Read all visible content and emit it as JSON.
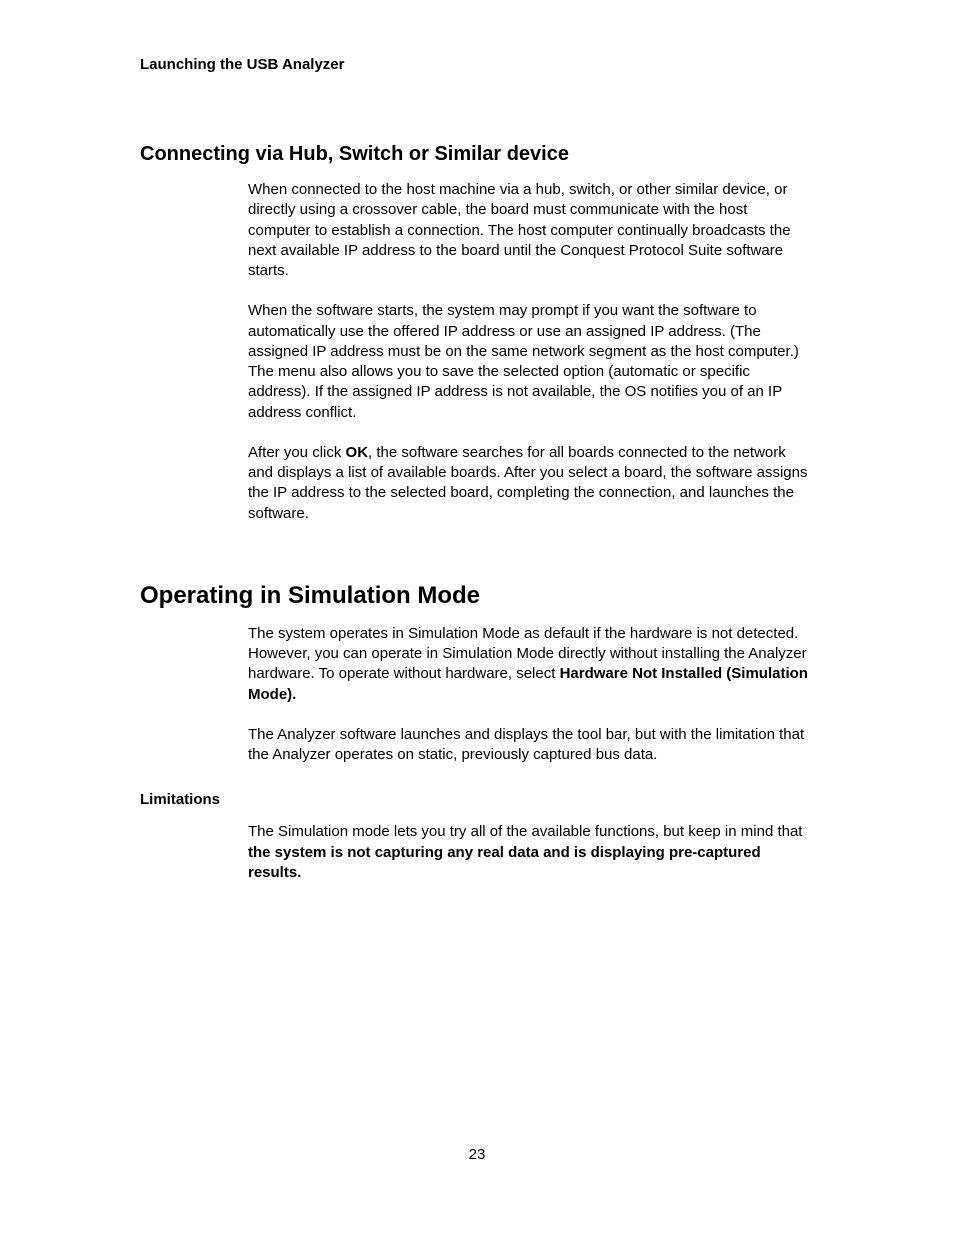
{
  "header": {
    "running": "Launching the USB Analyzer"
  },
  "section1": {
    "heading": "Connecting via Hub, Switch or Similar device",
    "p1": "When connected to the host machine via a hub, switch, or other similar device, or directly using a crossover cable, the board must communicate with the host computer to establish a connection. The host computer continually broadcasts the next available IP address to the board until the Conquest Protocol Suite software starts.",
    "p2": "When the software starts, the system may prompt if you want the software to automatically use the offered IP address or use an assigned IP address. (The assigned IP address must be on the same network segment as the host computer.) The menu also allows you to save the selected option (automatic or specific address). If the assigned IP address is not available, the OS notifies you of an IP address conflict.",
    "p3_a": "After you click ",
    "p3_bold": "OK",
    "p3_b": ", the software searches for all boards connected to the network and displays a list of available boards. After you select a board, the software assigns the IP address to the selected board, completing the connection, and launches the software."
  },
  "section2": {
    "heading": "Operating in Simulation Mode",
    "p1_a": "The system operates in Simulation Mode as default if the hardware is not detected. However, you can operate in Simulation Mode directly without installing the Analyzer hardware. To operate without hardware, select ",
    "p1_bold": "Hardware Not Installed (Simulation Mode).",
    "p2": "The Analyzer software launches and displays the tool bar, but with the limitation that the Analyzer operates on static, previously captured bus data.",
    "sub_heading": "Limitations",
    "p3_a": "The Simulation mode lets you try all of the available functions, but keep in mind that ",
    "p3_bold": "the system is not capturing any real data and is displaying pre-captured results."
  },
  "page_number": "23"
}
